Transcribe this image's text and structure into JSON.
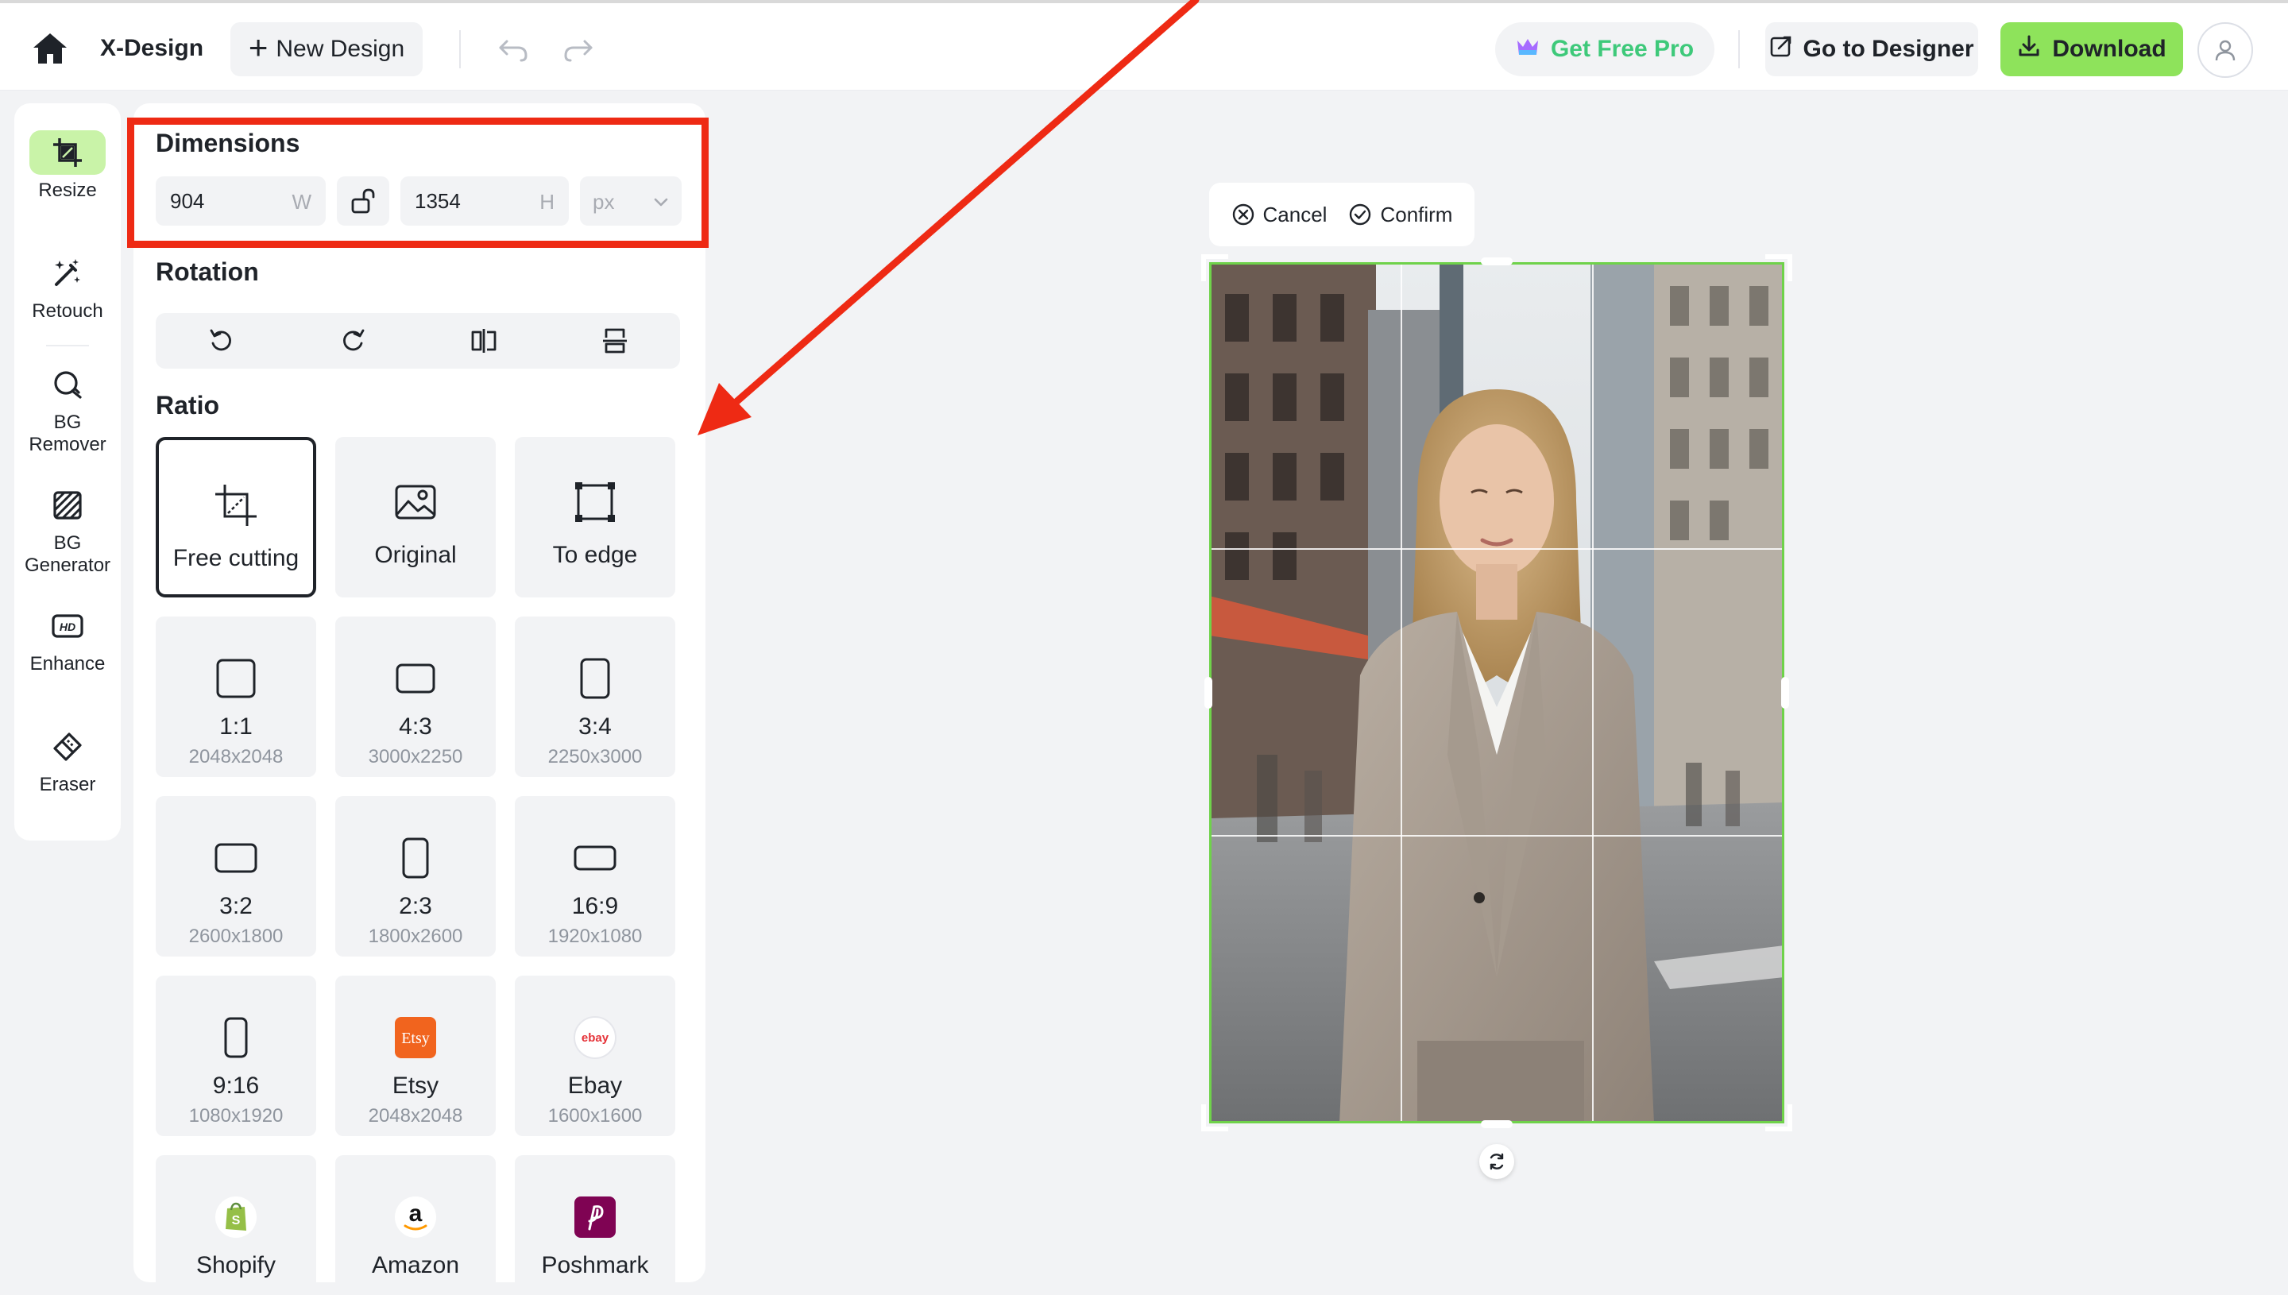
{
  "header": {
    "brand": "X-Design",
    "new_design_label": "New Design",
    "get_pro_label": "Get Free Pro",
    "go_to_designer_label": "Go to Designer",
    "download_label": "Download"
  },
  "tools": [
    {
      "label": "Resize",
      "icon": "crop-resize-icon",
      "active": true
    },
    {
      "label": "Retouch",
      "icon": "magic-wand-icon",
      "active": false
    },
    {
      "label": "BG Remover",
      "icon": "bg-remover-icon",
      "active": false
    },
    {
      "label": "BG Generator",
      "icon": "bg-generator-icon",
      "active": false
    },
    {
      "label": "Enhance",
      "icon": "hd-icon",
      "active": false
    },
    {
      "label": "Eraser",
      "icon": "eraser-icon",
      "active": false
    }
  ],
  "panel": {
    "dimensions_title": "Dimensions",
    "width_value": "904",
    "width_suffix": "W",
    "height_value": "1354",
    "height_suffix": "H",
    "unit_value": "px",
    "rotation_title": "Rotation",
    "ratio_title": "Ratio",
    "ratios": [
      {
        "name": "Free cutting",
        "size": "",
        "icon": "free-cutting-icon",
        "selected": true
      },
      {
        "name": "Original",
        "size": "",
        "icon": "image-icon",
        "selected": false
      },
      {
        "name": "To edge",
        "size": "",
        "icon": "to-edge-icon",
        "selected": false
      },
      {
        "name": "1:1",
        "size": "2048x2048",
        "icon": "square-icon"
      },
      {
        "name": "4:3",
        "size": "3000x2250",
        "icon": "landscape-4-3-icon"
      },
      {
        "name": "3:4",
        "size": "2250x3000",
        "icon": "portrait-3-4-icon"
      },
      {
        "name": "3:2",
        "size": "2600x1800",
        "icon": "landscape-3-2-icon"
      },
      {
        "name": "2:3",
        "size": "1800x2600",
        "icon": "portrait-2-3-icon"
      },
      {
        "name": "16:9",
        "size": "1920x1080",
        "icon": "landscape-16-9-icon"
      },
      {
        "name": "9:16",
        "size": "1080x1920",
        "icon": "portrait-9-16-icon"
      },
      {
        "name": "Etsy",
        "size": "2048x2048",
        "icon": "etsy-logo-icon"
      },
      {
        "name": "Ebay",
        "size": "1600x1600",
        "icon": "ebay-logo-icon"
      },
      {
        "name": "Shopify",
        "size": "",
        "icon": "shopify-logo-icon"
      },
      {
        "name": "Amazon",
        "size": "",
        "icon": "amazon-logo-icon"
      },
      {
        "name": "Poshmark",
        "size": "",
        "icon": "poshmark-logo-icon"
      }
    ],
    "etsy_logo_text": "Etsy",
    "ebay_logo_text": "ebay",
    "amazon_logo_text": "a"
  },
  "crop": {
    "cancel_label": "Cancel",
    "confirm_label": "Confirm"
  },
  "colors": {
    "accent_green": "#8ee35b",
    "pro_text_green": "#3ec97a",
    "crop_frame": "#6fd24a",
    "annotation_red": "#ee2a14"
  }
}
